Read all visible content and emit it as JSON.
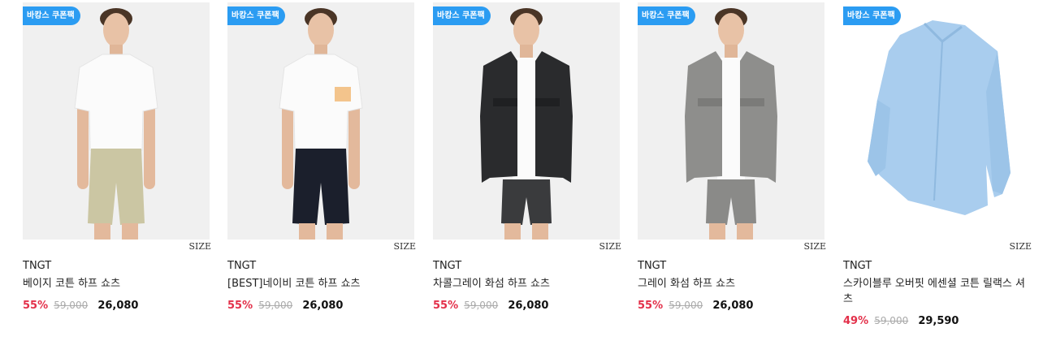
{
  "products": [
    {
      "badge": "바캉스 쿠폰팩",
      "size_label": "SIZE",
      "brand": "TNGT",
      "name": "베이지 코튼 하프 쇼츠",
      "discount": "55%",
      "original_price": "59,000",
      "sale_price": "26,080",
      "image": "model-white-tee-beige-shorts",
      "colors": {
        "top": "#fbfbfb",
        "bottom": "#cbc6a3"
      }
    },
    {
      "badge": "바캉스 쿠폰팩",
      "size_label": "SIZE",
      "brand": "TNGT",
      "name": "[BEST]네이비 코튼 하프 쇼츠",
      "discount": "55%",
      "original_price": "59,000",
      "sale_price": "26,080",
      "image": "model-white-tee-navy-shorts",
      "colors": {
        "top": "#fbfbfb",
        "bottom": "#1b1f2c"
      }
    },
    {
      "badge": "바캉스 쿠폰팩",
      "size_label": "SIZE",
      "brand": "TNGT",
      "name": "차콜그레이 화섬 하프 쇼츠",
      "discount": "55%",
      "original_price": "59,000",
      "sale_price": "26,080",
      "image": "model-black-jacket-charcoal-shorts",
      "colors": {
        "top": "#2a2b2d",
        "bottom": "#3a3b3d"
      }
    },
    {
      "badge": "바캉스 쿠폰팩",
      "size_label": "SIZE",
      "brand": "TNGT",
      "name": "그레이 화섬 하프 쇼츠",
      "discount": "55%",
      "original_price": "59,000",
      "sale_price": "26,080",
      "image": "model-grey-jacket-grey-shorts",
      "colors": {
        "top": "#8e8e8c",
        "bottom": "#8a8a88"
      }
    },
    {
      "badge": "바캉스 쿠폰팩",
      "size_label": "SIZE",
      "brand": "TNGT",
      "name": "스카이블루 오버핏 에센셜 코튼 릴랙스 셔츠",
      "discount": "49%",
      "original_price": "59,000",
      "sale_price": "29,590",
      "image": "skyblue-shirt-flatlay",
      "colors": {
        "top": "#a9cdee",
        "bottom": "#a9cdee"
      }
    }
  ],
  "colors": {
    "badge_bg": "#2b9cf2",
    "discount": "#e3304a",
    "strike": "#aaaaaa",
    "text": "#222222"
  }
}
